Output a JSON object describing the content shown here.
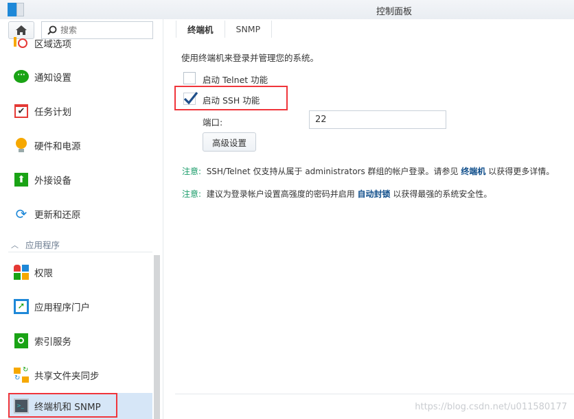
{
  "window": {
    "title": "控制面板"
  },
  "sidebar": {
    "search_placeholder": "搜索",
    "items_top": [
      {
        "label": "区域选项",
        "icon": "region-clock-icon"
      },
      {
        "label": "通知设置",
        "icon": "chat-bubble-icon"
      },
      {
        "label": "任务计划",
        "icon": "calendar-check-icon"
      },
      {
        "label": "硬件和电源",
        "icon": "lightbulb-icon"
      },
      {
        "label": "外接设备",
        "icon": "upload-device-icon"
      },
      {
        "label": "更新和还原",
        "icon": "refresh-icon"
      }
    ],
    "section": "应用程序",
    "items_app": [
      {
        "label": "权限",
        "icon": "permissions-icon"
      },
      {
        "label": "应用程序门户",
        "icon": "app-portal-icon"
      },
      {
        "label": "索引服务",
        "icon": "index-search-icon"
      },
      {
        "label": "共享文件夹同步",
        "icon": "folder-sync-icon"
      },
      {
        "label": "终端机和 SNMP",
        "icon": "terminal-icon",
        "selected": true
      }
    ]
  },
  "main": {
    "tabs": [
      {
        "label": "终端机",
        "active": true
      },
      {
        "label": "SNMP"
      }
    ],
    "description": "使用终端机来登录并管理您的系统。",
    "telnet": {
      "label": "启动 Telnet 功能",
      "checked": false
    },
    "ssh": {
      "label": "启动 SSH 功能",
      "checked": true
    },
    "port_label": "端口:",
    "port_value": "22",
    "advanced_button": "高级设置",
    "note1": {
      "label": "注意:",
      "text1": "SSH/Telnet 仅支持从属于 administrators 群组的帐户登录。请参见 ",
      "link": "终端机",
      "text2": " 以获得更多详情。"
    },
    "note2": {
      "label": "注意:",
      "text1": "建议为登录帐户设置高强度的密码并启用 ",
      "link": "自动封锁",
      "text2": " 以获得最强的系统安全性。"
    }
  },
  "watermark": "https://blog.csdn.net/u011580177",
  "colors": {
    "accent": "#0e4d8a",
    "note": "#1a9c6a",
    "highlight": "#f0343a",
    "selected": "#d6e6f7"
  }
}
